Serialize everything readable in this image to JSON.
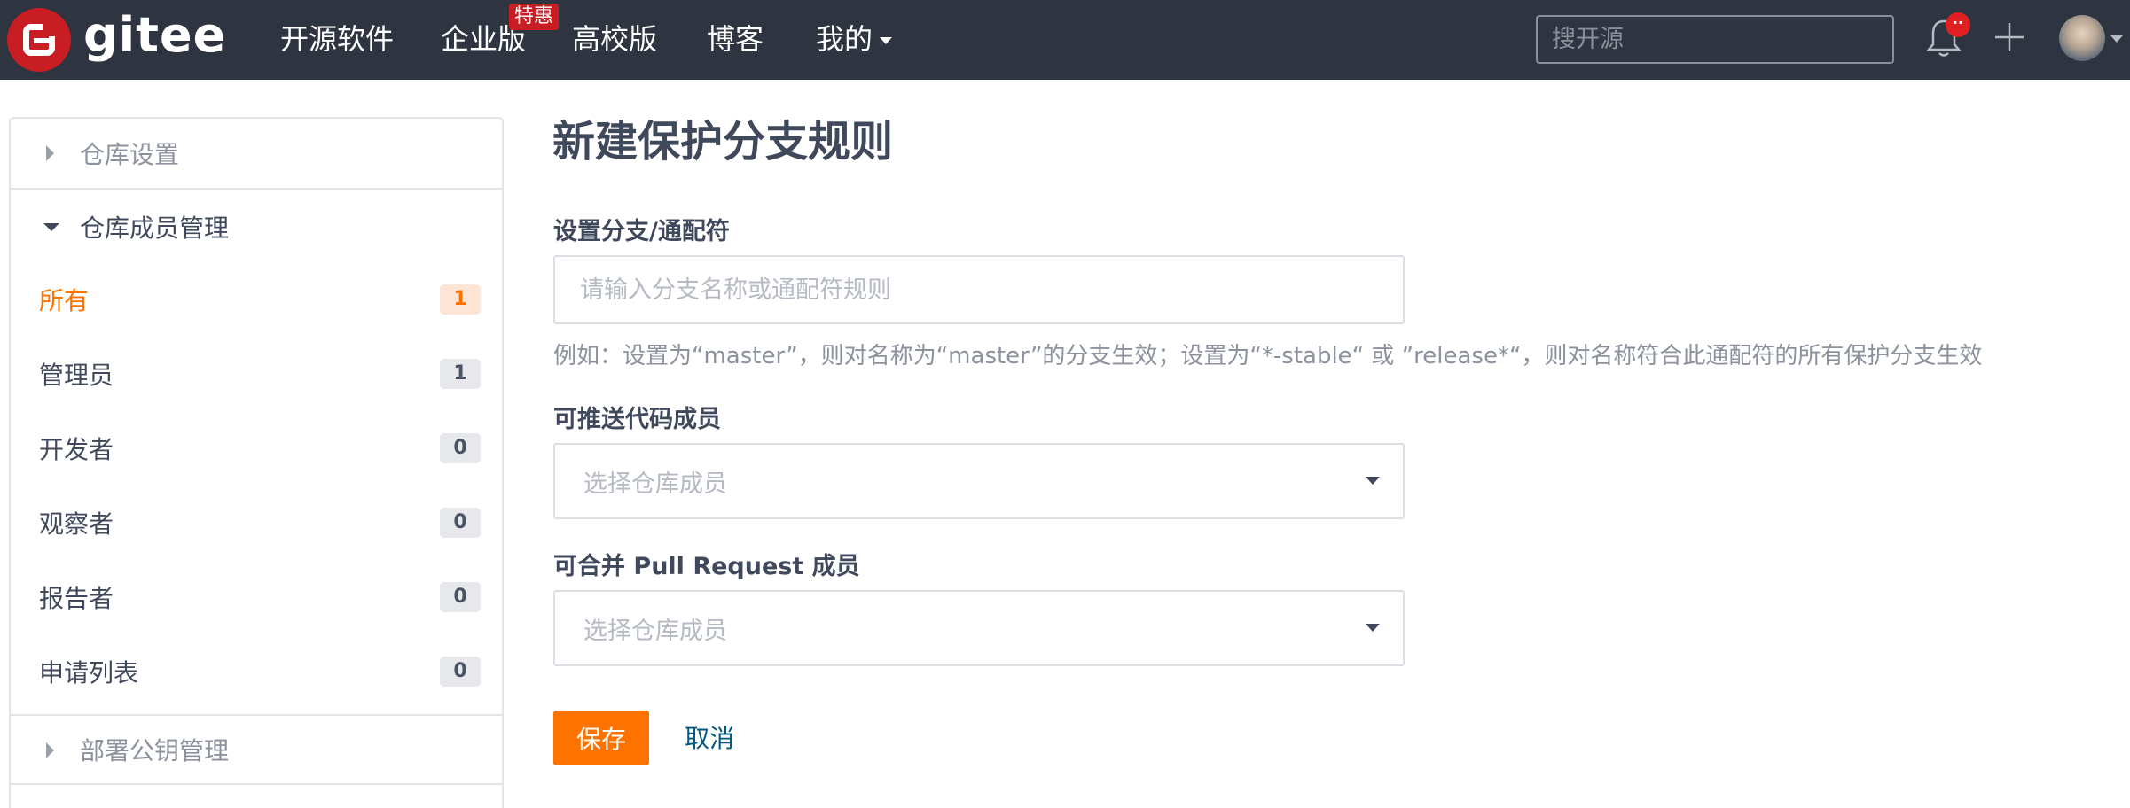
{
  "header": {
    "logo_text": "gitee",
    "nav": [
      "开源软件",
      "企业版",
      "高校版",
      "博客",
      "我的"
    ],
    "enterprise_badge": "特惠",
    "search_placeholder": "搜开源",
    "notification_badge": "··"
  },
  "sidebar": {
    "sections": [
      {
        "label": "仓库设置",
        "expanded": false
      },
      {
        "label": "仓库成员管理",
        "expanded": true
      },
      {
        "label": "部署公钥管理",
        "expanded": false
      }
    ],
    "items": [
      {
        "label": "所有",
        "count": "1",
        "active": true
      },
      {
        "label": "管理员",
        "count": "1"
      },
      {
        "label": "开发者",
        "count": "0"
      },
      {
        "label": "观察者",
        "count": "0"
      },
      {
        "label": "报告者",
        "count": "0"
      },
      {
        "label": "申请列表",
        "count": "0"
      }
    ]
  },
  "main": {
    "title": "新建保护分支规则",
    "branch_label": "设置分支/通配符",
    "branch_placeholder": "请输入分支名称或通配符规则",
    "hint": "例如：设置为“master”，则对名称为“master”的分支生效；设置为“*-stable“ 或 ”release*“，则对名称符合此通配符的所有保护分支生效",
    "push_label": "可推送代码成员",
    "push_placeholder": "选择仓库成员",
    "merge_label": "可合并 Pull Request 成员",
    "merge_placeholder": "选择仓库成员",
    "save_label": "保存",
    "cancel_label": "取消"
  },
  "colors": {
    "topbar": "#2e3440",
    "brand_red": "#c71d23",
    "accent_orange": "#fe7300",
    "link": "#005980"
  }
}
